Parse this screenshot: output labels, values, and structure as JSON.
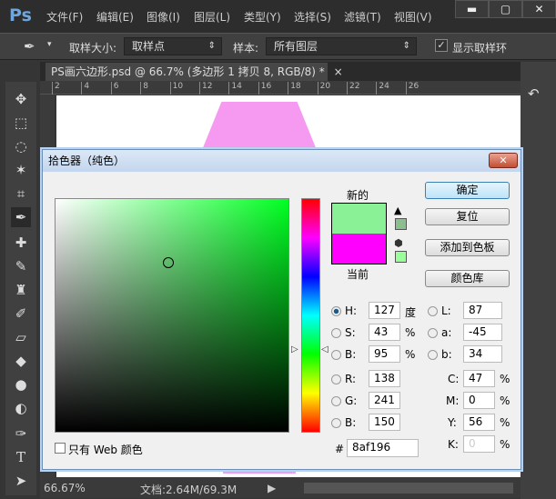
{
  "app": {
    "logo": "Ps",
    "menu": [
      "文件(F)",
      "编辑(E)",
      "图像(I)",
      "图层(L)",
      "类型(Y)",
      "选择(S)",
      "滤镜(T)",
      "视图(V)"
    ],
    "window_controls": [
      "▬",
      "▢",
      "✕"
    ]
  },
  "options": {
    "sample_size_label": "取样大小:",
    "sample_size_value": "取样点",
    "sample_label": "样本:",
    "sample_value": "所有图层",
    "show_ring_label": "显示取样环",
    "show_ring_checked": true
  },
  "document": {
    "tab_title": "PS画六边形.psd @ 66.7% (多边形 1 拷贝 8, RGB/8) *",
    "close": "×",
    "ruler_ticks": [
      "2",
      "4",
      "6",
      "8",
      "10",
      "12",
      "14",
      "16",
      "18",
      "20",
      "22",
      "24",
      "26"
    ]
  },
  "status": {
    "zoom": "66.67%",
    "doc": "文档:2.64M/69.3M"
  },
  "dialog": {
    "title": "拾色器（纯色）",
    "close": "✕",
    "new_label": "新的",
    "current_label": "当前",
    "new_color": "#8af196",
    "current_color": "#ff00ff",
    "buttons": {
      "ok": "确定",
      "reset": "复位",
      "add_swatch": "添加到色板",
      "libraries": "颜色库"
    },
    "fields": {
      "H": "127",
      "S": "43",
      "B": "95",
      "R": "138",
      "G": "241",
      "B2": "150",
      "L": "87",
      "a": "-45",
      "b": "34",
      "C": "47",
      "M": "0",
      "Y": "56",
      "K": "0",
      "hex": "8af196"
    },
    "labels": {
      "H": "H:",
      "S": "S:",
      "B": "B:",
      "R": "R:",
      "G": "G:",
      "B2": "B:",
      "L": "L:",
      "a": "a:",
      "b": "b:",
      "C": "C:",
      "M": "M:",
      "Y": "Y:",
      "K": "K:",
      "deg": "度",
      "pct": "%",
      "hash": "#"
    },
    "selected_mode": "H",
    "web_only_label": "只有 Web 颜色",
    "web_only_checked": false
  }
}
